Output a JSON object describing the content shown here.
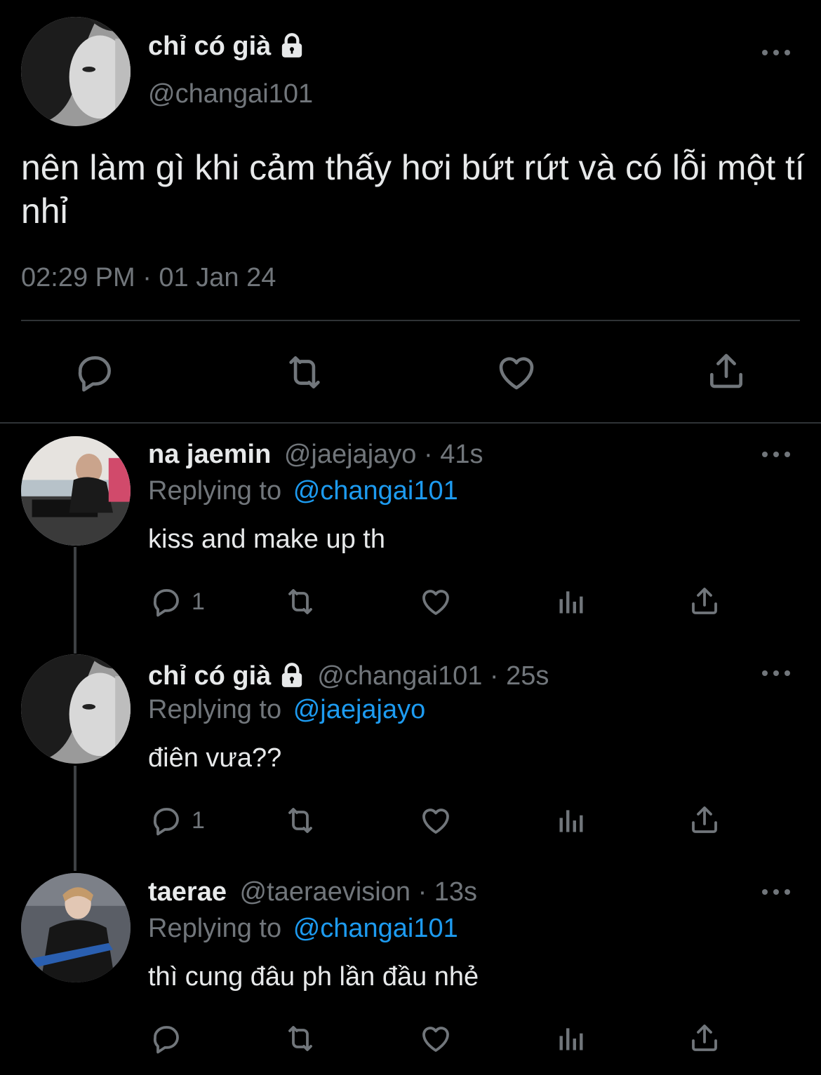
{
  "main_tweet": {
    "display_name": "chỉ có già",
    "handle": "@changai101",
    "text": "nên làm gì khi cảm thấy hơi bứt rứt và có lỗi một tí nhỉ",
    "timestamp": "02:29 PM · 01 Jan 24",
    "locked": true
  },
  "replies": [
    {
      "display_name": "na jaemin",
      "handle_time": "@jaejajayo · 41s",
      "replying_prefix": "Replying to",
      "replying_to": "@changai101",
      "text": "kiss and make up th",
      "reply_count": "1",
      "locked": false
    },
    {
      "display_name": "chỉ có già",
      "handle_time": "@changai101 · 25s",
      "replying_prefix": "Replying to",
      "replying_to": "@jaejajayo",
      "text": "điên vưa??",
      "reply_count": "1",
      "locked": true
    },
    {
      "display_name": "taerae",
      "handle_time": "@taeraevision · 13s",
      "replying_prefix": "Replying to",
      "replying_to": "@changai101",
      "text": "thì cung đâu ph lần đầu nhẻ",
      "reply_count": "",
      "locked": false
    }
  ],
  "icons": {
    "reply": "speech-bubble-icon",
    "retweet": "retweet-icon",
    "like": "heart-icon",
    "views": "bar-chart-icon",
    "share": "share-icon",
    "more": "more-dots-icon",
    "lock": "lock-icon"
  },
  "colors": {
    "background": "#000000",
    "text": "#e7e9ea",
    "muted": "#71767b",
    "accent": "#1d9bf0",
    "divider": "#2f3336"
  }
}
